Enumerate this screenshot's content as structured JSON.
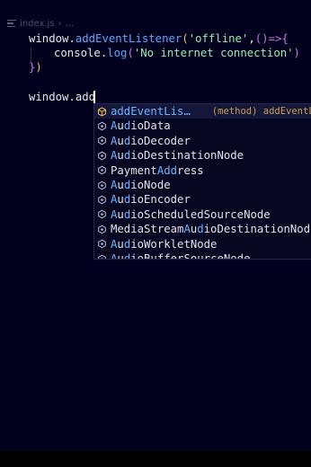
{
  "breadcrumb": {
    "file": "index.js",
    "rest": "…"
  },
  "code": {
    "line1": {
      "obj": "window",
      "dot": ".",
      "method": "addEventListener",
      "open": "(",
      "arg": "'offline'",
      "comma": ",",
      "parens": "()",
      "arrow": "=>",
      "brace": "{"
    },
    "line2": {
      "obj": "console",
      "dot": ".",
      "method": "log",
      "open": "(",
      "arg": "'No internet connection'",
      "close": ")"
    },
    "line3": {
      "brace": "}",
      "close": ")"
    },
    "line4": {
      "text": "window.add"
    }
  },
  "suggestions": {
    "items": [
      {
        "pre": "",
        "match": "add",
        "post": "EventLis…",
        "icon": "method-icon",
        "detail": "(method) addEventLi"
      },
      {
        "pre": "",
        "match": "A",
        "post": "u",
        "match2": "d",
        "post2": "ioData",
        "icon": "class-icon"
      },
      {
        "pre": "",
        "match": "A",
        "post": "u",
        "match2": "d",
        "post2": "ioDecoder",
        "icon": "class-icon"
      },
      {
        "pre": "",
        "match": "A",
        "post": "u",
        "match2": "d",
        "post2": "ioDestinationNode",
        "icon": "class-icon"
      },
      {
        "pre": "Payment",
        "match": "Add",
        "post": "ress",
        "icon": "class-icon"
      },
      {
        "pre": "",
        "match": "A",
        "post": "u",
        "match2": "d",
        "post2": "ioNode",
        "icon": "class-icon"
      },
      {
        "pre": "",
        "match": "A",
        "post": "u",
        "match2": "d",
        "post2": "ioEncoder",
        "icon": "class-icon"
      },
      {
        "pre": "",
        "match": "A",
        "post": "u",
        "match2": "d",
        "post2": "ioScheduledSourceNode",
        "icon": "class-icon"
      },
      {
        "pre": "MediaStream",
        "match": "A",
        "post": "u",
        "match2": "d",
        "post2": "ioDestinationNode",
        "icon": "class-icon"
      },
      {
        "pre": "",
        "match": "A",
        "post": "u",
        "match2": "d",
        "post2": "ioWorkletNode",
        "icon": "class-icon"
      },
      {
        "pre": "",
        "match": "A",
        "post": "u",
        "match2": "d",
        "post2": "ioBufferSourceNode",
        "icon": "class-icon"
      }
    ]
  },
  "colors": {
    "background": "#02021e",
    "method": "#5ba8ff",
    "string": "#9ee8b4",
    "highlight": "#6cb4ff"
  }
}
